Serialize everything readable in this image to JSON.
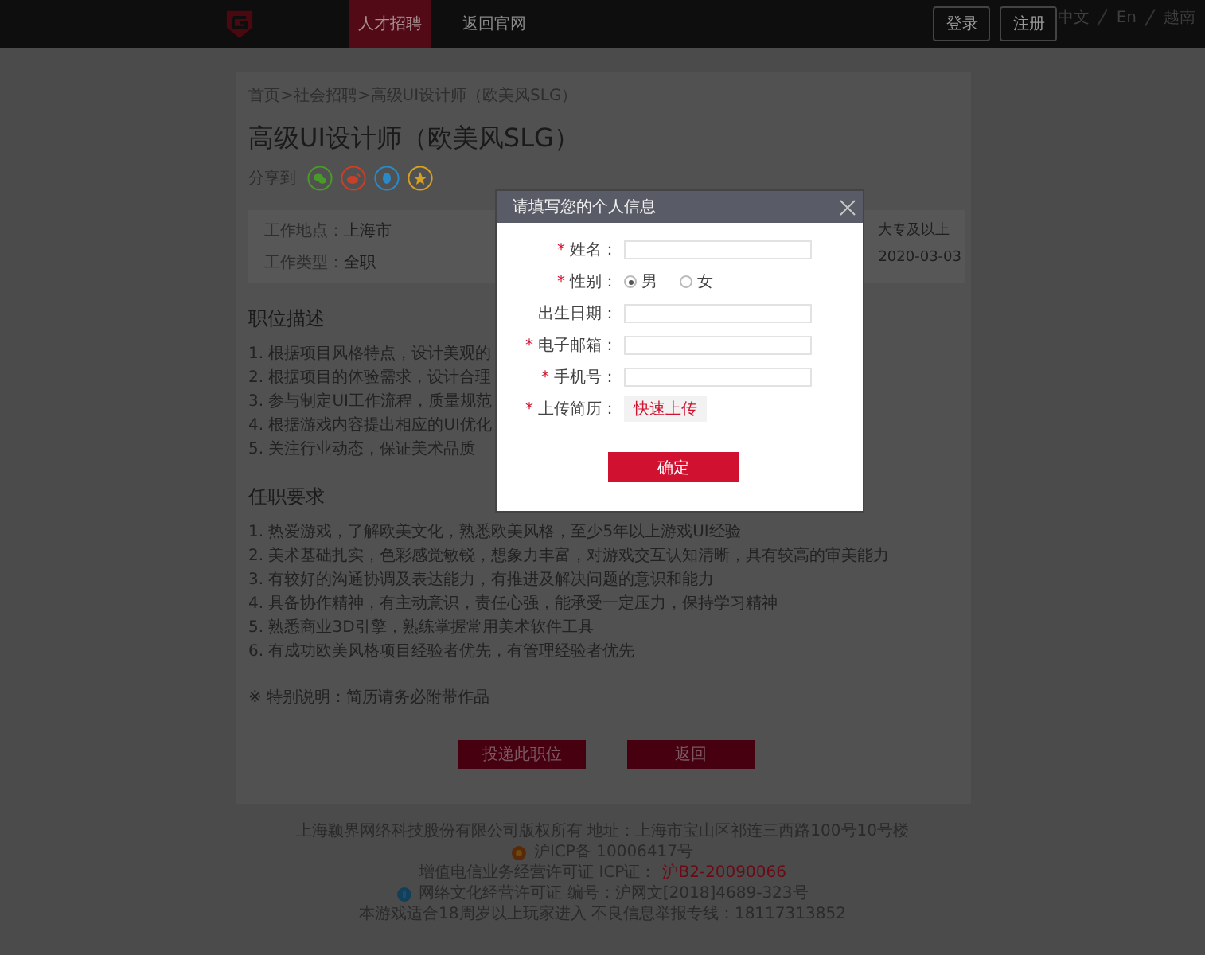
{
  "header": {
    "nav": [
      {
        "label": "人才招聘",
        "selected": true
      },
      {
        "label": "返回官网",
        "selected": false
      }
    ],
    "buttons": [
      "登录",
      "注册"
    ],
    "languages": [
      "中文",
      "En",
      "越南"
    ]
  },
  "job": {
    "breadcrumb": "首页>社会招聘>高级UI设计师（欧美风SLG）",
    "title": "高级UI设计师（欧美风SLG）",
    "share_label": "分享到",
    "share": [
      {
        "kind": "wechat",
        "color": "#4a9a2a"
      },
      {
        "kind": "weibo",
        "color": "#c8402a"
      },
      {
        "kind": "qq",
        "color": "#2a8ac8"
      },
      {
        "kind": "favorite",
        "color": "#d8a020"
      }
    ],
    "info_left": [
      {
        "label": "工作地点：",
        "value": "上海市"
      },
      {
        "label": "工作类型：",
        "value": "全职"
      }
    ],
    "info_right": [
      "大专及以上",
      "2020-03-03"
    ],
    "sections": [
      {
        "heading": "职位描述",
        "items": [
          "1. 根据项目风格特点，设计美观的",
          "2. 根据项目的体验需求，设计合理",
          "3. 参与制定UI工作流程，质量规范",
          "4. 根据游戏内容提出相应的UI优化",
          "5. 关注行业动态，保证美术品质"
        ]
      },
      {
        "heading": "任职要求",
        "items": [
          "1. 热爱游戏，了解欧美文化，熟悉欧美风格，至少5年以上游戏UI经验",
          "2. 美术基础扎实，色彩感觉敏锐，想象力丰富，对游戏交互认知清晰，具有较高的审美能力",
          "3. 有较好的沟通协调及表达能力，有推进及解决问题的意识和能力",
          "4. 具备协作精神，有主动意识，责任心强，能承受一定压力，保持学习精神",
          "5. 熟悉商业3D引擎，熟练掌握常用美术软件工具",
          "6. 有成功欧美风格项目经验者优先，有管理经验者优先"
        ]
      }
    ],
    "note": "※ 特别说明：简历请务必附带作品",
    "buttons": [
      "投递此职位",
      "返回"
    ]
  },
  "modal": {
    "title": "请填写您的个人信息",
    "fields": [
      {
        "kind": "input",
        "mark": "*",
        "label": "姓名："
      },
      {
        "kind": "radio",
        "mark": "*",
        "label": "性别：",
        "options": [
          {
            "label": "男",
            "selected": true
          },
          {
            "label": "女",
            "selected": false
          }
        ]
      },
      {
        "kind": "input",
        "label": "出生日期："
      },
      {
        "kind": "input",
        "mark": "*",
        "label": "电子邮箱："
      },
      {
        "kind": "input",
        "mark": "*",
        "label": "手机号："
      },
      {
        "kind": "upload",
        "mark": "*",
        "label": "上传简历：",
        "button": "快速上传"
      }
    ],
    "submit": "确定"
  },
  "footer": [
    {
      "text": "上海颖界网络科技股份有限公司版权所有 地址：上海市宝山区祁连三西路100号10号楼"
    },
    {
      "kind": "emblem",
      "text": "沪ICP备 10006417号"
    },
    {
      "text": "增值电信业务经营许可证 ICP证：",
      "highlight": "沪B2-20090066"
    },
    {
      "kind": "culture",
      "text": "网络文化经营许可证 编号：沪网文[2018]4689-323号"
    },
    {
      "text": "本游戏适合18周岁以上玩家进入 不良信息举报专线：18117313852"
    }
  ]
}
